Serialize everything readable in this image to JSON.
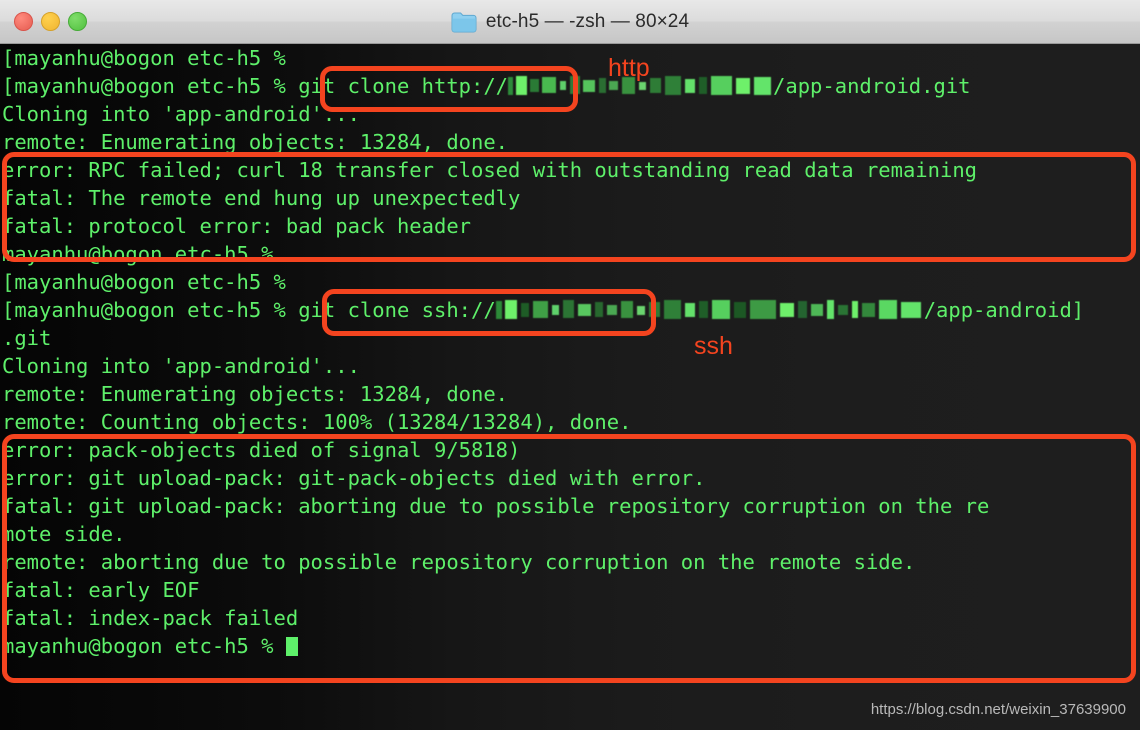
{
  "window": {
    "title": "etc-h5 — -zsh — 80×24",
    "folder_icon": "folder-icon",
    "buttons": {
      "close": "close-button",
      "minimize": "minimize-button",
      "maximize": "maximize-button"
    }
  },
  "terminal": {
    "prompt": "[mayanhu@bogon etc-h5 % ",
    "lines": [
      {
        "id": "l1",
        "text": "[mayanhu@bogon etc-h5 % "
      },
      {
        "id": "l2",
        "text": "[mayanhu@bogon etc-h5 % git clone http://",
        "redacted": true,
        "suffix": "/app-android.git"
      },
      {
        "id": "l3",
        "text": "Cloning into 'app-android'..."
      },
      {
        "id": "l4",
        "text": "remote: Enumerating objects: 13284, done."
      },
      {
        "id": "l5",
        "text": "error: RPC failed; curl 18 transfer closed with outstanding read data remaining"
      },
      {
        "id": "l6",
        "text": "fatal: The remote end hung up unexpectedly"
      },
      {
        "id": "l7",
        "text": "fatal: protocol error: bad pack header"
      },
      {
        "id": "l8",
        "text": "mayanhu@bogon etc-h5 %"
      },
      {
        "id": "l9",
        "text": "[mayanhu@bogon etc-h5 % "
      },
      {
        "id": "l10",
        "text": "[mayanhu@bogon etc-h5 % git clone ssh://",
        "redacted": true,
        "suffix": "/app-android]"
      },
      {
        "id": "l11",
        "text": ".git"
      },
      {
        "id": "l12",
        "text": "Cloning into 'app-android'..."
      },
      {
        "id": "l13",
        "text": "remote: Enumerating objects: 13284, done."
      },
      {
        "id": "l14",
        "text": "remote: Counting objects: 100% (13284/13284), done."
      },
      {
        "id": "l15",
        "text": "error: pack-objects died of signal 9/5818)"
      },
      {
        "id": "l16",
        "text": "error: git upload-pack: git-pack-objects died with error."
      },
      {
        "id": "l17",
        "text": "fatal: git upload-pack: aborting due to possible repository corruption on the re"
      },
      {
        "id": "l18",
        "text": "mote side."
      },
      {
        "id": "l19",
        "text": "remote: aborting due to possible repository corruption on the remote side."
      },
      {
        "id": "l20",
        "text": "fatal: early EOF"
      },
      {
        "id": "l21",
        "text": "fatal: index-pack failed"
      },
      {
        "id": "l22",
        "text": "mayanhu@bogon etc-h5 % ",
        "cursor": true
      }
    ]
  },
  "annotations": {
    "label_http": "http",
    "label_ssh": "ssh",
    "box_color": "#f4441f"
  },
  "watermark": "https://blog.csdn.net/weixin_37639900",
  "colors": {
    "terminal_text": "#5ef06a",
    "terminal_bg_left": "#050505",
    "terminal_bg_right": "#1e1e1e",
    "annotation_red": "#f4441f",
    "titlebar": "#dcdcdc"
  }
}
